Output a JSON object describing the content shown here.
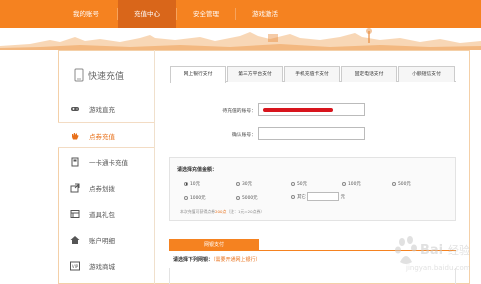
{
  "topnav": {
    "tabs": [
      {
        "label": "我的账号"
      },
      {
        "label": "充值中心",
        "active": true
      },
      {
        "label": "安全管理"
      },
      {
        "label": "游戏激活"
      }
    ]
  },
  "sidebar": {
    "title": "快速充值",
    "items": [
      {
        "label": "游戏直充",
        "icon": "gamepad-icon"
      },
      {
        "label": "点券充值",
        "icon": "hand-icon",
        "active": true
      },
      {
        "label": "一卡通卡充值",
        "icon": "card-icon"
      },
      {
        "label": "点券划拨",
        "icon": "transfer-icon"
      },
      {
        "label": "道具礼包",
        "icon": "gift-icon"
      },
      {
        "label": "账户明细",
        "icon": "home-icon"
      },
      {
        "label": "游戏商城",
        "icon": "vip-icon"
      }
    ]
  },
  "pay_tabs": [
    {
      "label": "网上银行支付",
      "active": true
    },
    {
      "label": "第三方平台支付"
    },
    {
      "label": "手机充值卡支付"
    },
    {
      "label": "固定电话支付"
    },
    {
      "label": "小额短信支付"
    }
  ],
  "form": {
    "account_label": "待充值的账号：",
    "confirm_label": "确认账号："
  },
  "amount": {
    "title": "请选择充值金额：",
    "options": [
      "10元",
      "30元",
      "50元",
      "100元",
      "500元",
      "1000元",
      "5000元",
      "其它"
    ],
    "selected": "10元",
    "other_unit": "元",
    "hint_prefix": "本次充值可获得点券",
    "hint_value": "200点",
    "hint_suffix": "（注：1元=20点券）"
  },
  "bank": {
    "tab_label": "网银支付",
    "title": "请选择下列网银：",
    "title_note": "（需要开通网上银行）"
  },
  "colors": {
    "accent": "#f58220",
    "accent_dark": "#d9661a",
    "link": "#e8701a"
  }
}
